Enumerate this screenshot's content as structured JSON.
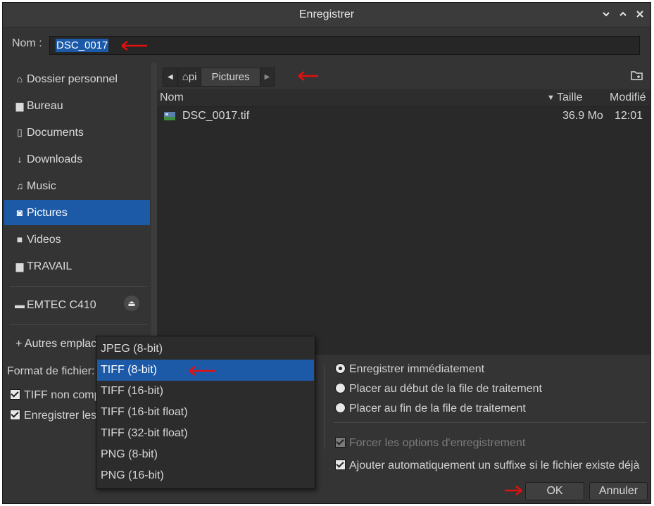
{
  "window": {
    "title": "Enregistrer",
    "controls": [
      "chevron-down-icon",
      "chevron-up-icon",
      "close-icon"
    ]
  },
  "name_row": {
    "label": "Nom :",
    "value": "DSC_0017"
  },
  "sidebar": {
    "items": [
      {
        "label": "Dossier personnel",
        "icon": "home-icon"
      },
      {
        "label": "Bureau",
        "icon": "folder-icon"
      },
      {
        "label": "Documents",
        "icon": "document-icon"
      },
      {
        "label": "Downloads",
        "icon": "download-icon"
      },
      {
        "label": "Music",
        "icon": "music-icon"
      },
      {
        "label": "Pictures",
        "icon": "camera-icon",
        "selected": true
      },
      {
        "label": "Videos",
        "icon": "video-icon"
      },
      {
        "label": "TRAVAIL",
        "icon": "folder-icon"
      }
    ],
    "device": {
      "label": "EMTEC C410",
      "icon": "drive-icon"
    },
    "other_locations": "+ Autres emplac"
  },
  "pathbar": {
    "home": "pi",
    "current": "Pictures"
  },
  "columns": {
    "name": "Nom",
    "size": "Taille",
    "modified": "Modifié"
  },
  "files": [
    {
      "name": "DSC_0017.tif",
      "size": "36.9 Mo",
      "modified": "12:01"
    }
  ],
  "options": {
    "format_label": "Format de fichier:",
    "tiff_uncompressed": "TIFF non comp",
    "save_params": "Enregistrer les",
    "radio_now": "Enregistrer immédiatement",
    "radio_queue_start": "Placer au début de la file de traitement",
    "radio_queue_end": "Placer au fin de la file de traitement",
    "force_options": "Forcer les options d'enregistrement",
    "auto_suffix": "Ajouter automatiquement un suffixe si le fichier existe déjà"
  },
  "format_menu": [
    "JPEG (8-bit)",
    "TIFF (8-bit)",
    "TIFF (16-bit)",
    "TIFF (16-bit float)",
    "TIFF (32-bit float)",
    "PNG (8-bit)",
    "PNG (16-bit)"
  ],
  "format_selected": "TIFF (8-bit)",
  "buttons": {
    "ok": "OK",
    "cancel": "Annuler"
  },
  "colors": {
    "accent": "#1c5aa8",
    "annotation_arrow": "#e01010"
  }
}
